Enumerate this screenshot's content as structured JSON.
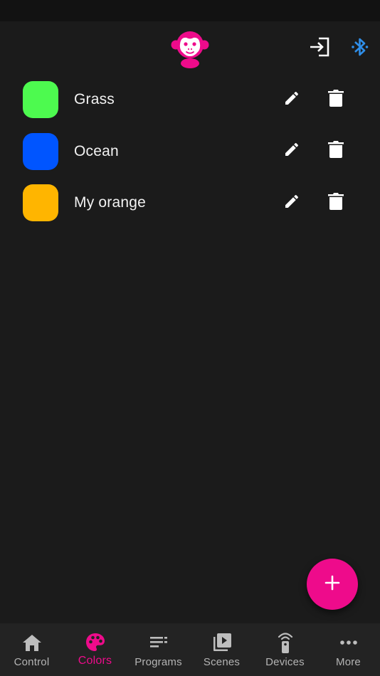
{
  "colors": {
    "accent": "#ee0b8b",
    "bluetooth": "#2f8ee8",
    "background": "#1b1b1b",
    "nav_background": "#232323"
  },
  "header": {
    "logo_icon": "monkey-logo-icon",
    "login_icon": "login-icon",
    "bluetooth_icon": "bluetooth-icon"
  },
  "color_items": [
    {
      "name": "Grass",
      "swatch": "#4dfa4f",
      "edit_icon": "pencil-icon",
      "delete_icon": "trash-icon"
    },
    {
      "name": "Ocean",
      "swatch": "#0055ff",
      "edit_icon": "pencil-icon",
      "delete_icon": "trash-icon"
    },
    {
      "name": "My orange",
      "swatch": "#ffb500",
      "edit_icon": "pencil-icon",
      "delete_icon": "trash-icon"
    }
  ],
  "fab": {
    "icon": "plus-icon"
  },
  "nav": {
    "items": [
      {
        "label": "Control",
        "icon": "home-icon"
      },
      {
        "label": "Colors",
        "icon": "palette-icon"
      },
      {
        "label": "Programs",
        "icon": "playlist-icon"
      },
      {
        "label": "Scenes",
        "icon": "video-library-icon"
      },
      {
        "label": "Devices",
        "icon": "remote-icon"
      },
      {
        "label": "More",
        "icon": "more-horizontal-icon"
      }
    ],
    "active": "Colors"
  }
}
